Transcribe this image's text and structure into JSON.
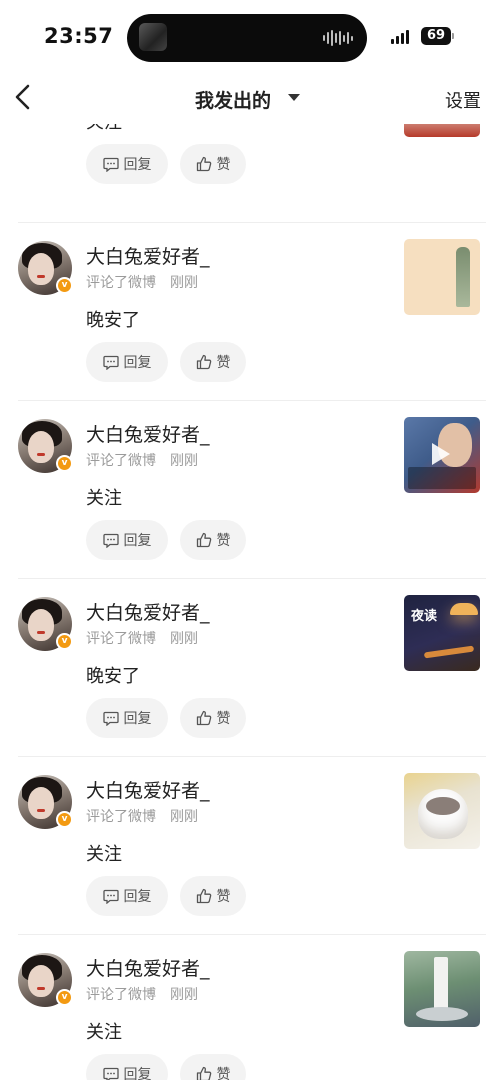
{
  "status_bar": {
    "time": "23:57",
    "battery": "69"
  },
  "nav": {
    "title": "我发出的",
    "settings": "设置"
  },
  "partial_item": {
    "content": "关注",
    "reply_label": "回复",
    "like_label": "赞"
  },
  "items": [
    {
      "username": "大白兔爱好者_",
      "action": "评论了微博",
      "time": "刚刚",
      "content": "晚安了",
      "reply_label": "回复",
      "like_label": "赞"
    },
    {
      "username": "大白兔爱好者_",
      "action": "评论了微博",
      "time": "刚刚",
      "content": "关注",
      "reply_label": "回复",
      "like_label": "赞"
    },
    {
      "username": "大白兔爱好者_",
      "action": "评论了微博",
      "time": "刚刚",
      "content": "晚安了",
      "reply_label": "回复",
      "like_label": "赞",
      "thumb_text": "夜读"
    },
    {
      "username": "大白兔爱好者_",
      "action": "评论了微博",
      "time": "刚刚",
      "content": "关注",
      "reply_label": "回复",
      "like_label": "赞"
    },
    {
      "username": "大白兔爱好者_",
      "action": "评论了微博",
      "time": "刚刚",
      "content": "关注",
      "reply_label": "回复",
      "like_label": "赞"
    }
  ],
  "colors": {
    "accent_badge": "#f39a12",
    "pill_bg": "#f3f3f3",
    "meta_text": "#9b9b9b"
  },
  "icons": {
    "back": "chevron-left-icon",
    "reply": "comment-icon",
    "like": "thumbs-up-icon",
    "verified": "verified-badge-icon"
  }
}
